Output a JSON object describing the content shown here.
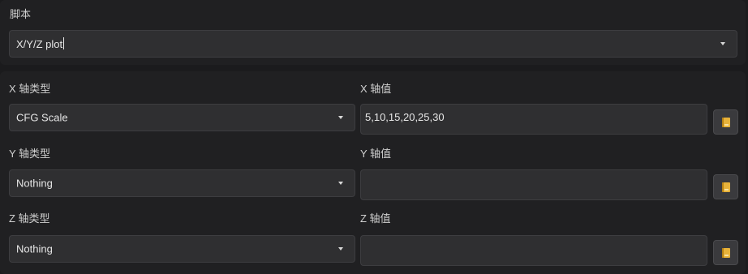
{
  "script": {
    "label": "脚本",
    "selected": "X/Y/Z plot"
  },
  "axes": [
    {
      "type_label": "X 轴类型",
      "type_value": "CFG Scale",
      "values_label": "X 轴值",
      "values_value": "5,10,15,20,25,30"
    },
    {
      "type_label": "Y 轴类型",
      "type_value": "Nothing",
      "values_label": "Y 轴值",
      "values_value": ""
    },
    {
      "type_label": "Z 轴类型",
      "type_value": "Nothing",
      "values_label": "Z 轴值",
      "values_value": ""
    }
  ],
  "icons": {
    "chevron": "chevron-down-icon",
    "helper_button": "book-icon"
  },
  "colors": {
    "background": "#1b1b1d",
    "panel": "#202022",
    "input": "#2f2f31",
    "icon_accent": "#e7b23a"
  }
}
